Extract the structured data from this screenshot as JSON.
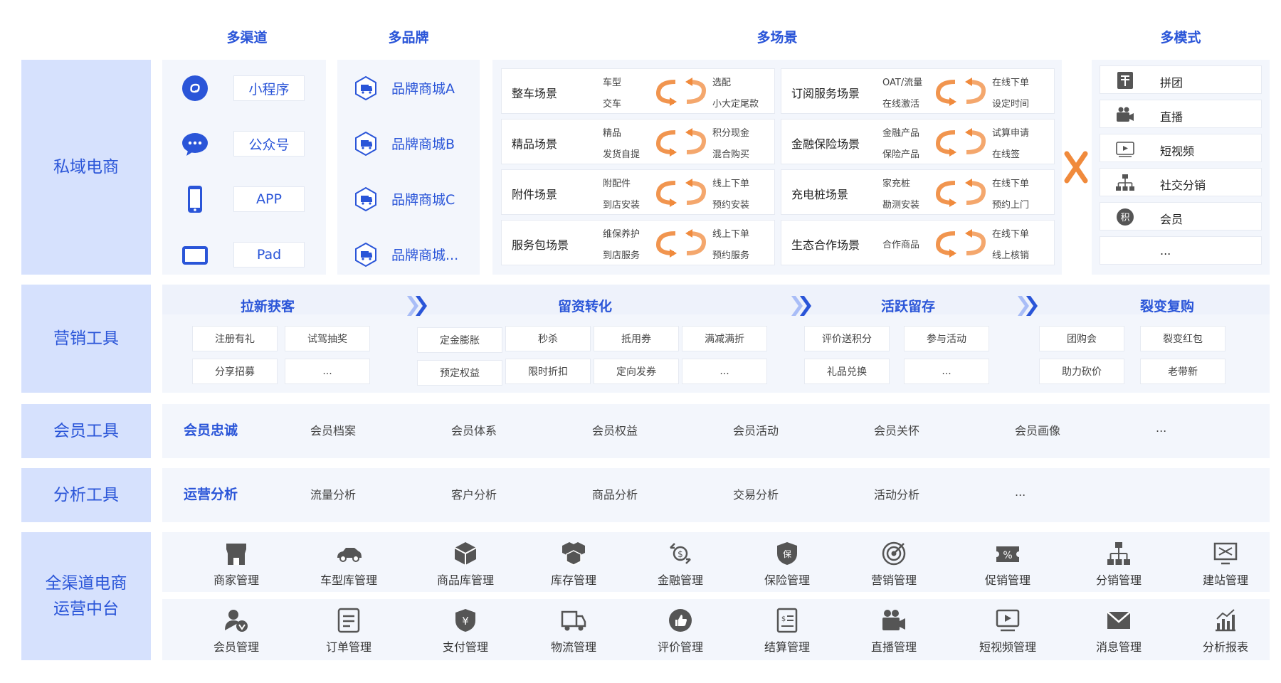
{
  "columns": {
    "channels": "多渠道",
    "brands": "多品牌",
    "scenes": "多场景",
    "modes": "多模式"
  },
  "rows": {
    "private": "私域电商",
    "marketing": "营销工具",
    "member": "会员工具",
    "analysis": "分析工具",
    "platform_line1": "全渠道电商",
    "platform_line2": "运营中台"
  },
  "channels": [
    "小程序",
    "公众号",
    "APP",
    "Pad"
  ],
  "brands": [
    "品牌商城A",
    "品牌商城B",
    "品牌商城C",
    "品牌商城..."
  ],
  "scenes": [
    {
      "name": "整车场景",
      "tl": "车型",
      "bl": "交车",
      "tr": "选配",
      "br": "小大定尾款"
    },
    {
      "name": "订阅服务场景",
      "tl": "OAT/流量",
      "bl": "在线激活",
      "tr": "在线下单",
      "br": "设定时间"
    },
    {
      "name": "精品场景",
      "tl": "精品",
      "bl": "发货自提",
      "tr": "积分现金",
      "br": "混合购买"
    },
    {
      "name": "金融保险场景",
      "tl": "金融产品",
      "bl": "保险产品",
      "tr": "试算申请",
      "br": "在线签"
    },
    {
      "name": "附件场景",
      "tl": "附配件",
      "bl": "到店安装",
      "tr": "线上下单",
      "br": "预约安装"
    },
    {
      "name": "充电桩场景",
      "tl": "家充桩",
      "bl": "勘测安装",
      "tr": "在线下单",
      "br": "预约上门"
    },
    {
      "name": "服务包场景",
      "tl": "维保养护",
      "bl": "到店服务",
      "tr": "线上下单",
      "br": "预约服务"
    },
    {
      "name": "生态合作场景",
      "tl": "合作商品",
      "bl": "",
      "tr": "在线下单",
      "br": "线上核销"
    }
  ],
  "cross_mark": "X",
  "modes": [
    "拼团",
    "直播",
    "短视频",
    "社交分销",
    "会员",
    "..."
  ],
  "mode_icons": [
    "group-buy-icon",
    "live-camera-icon",
    "video-play-icon",
    "org-chart-icon",
    "points-icon",
    ""
  ],
  "marketing": {
    "stages": [
      "拉新获客",
      "留资转化",
      "活跃留存",
      "裂变复购"
    ],
    "acquire": [
      "注册有礼",
      "试驾抽奖",
      "分享招募",
      "..."
    ],
    "convert": [
      "定金膨胀",
      "秒杀",
      "抵用券",
      "满减满折",
      "预定权益",
      "限时折扣",
      "定向发券",
      "..."
    ],
    "retain": [
      "评价送积分",
      "参与活动",
      "礼品兑换",
      "..."
    ],
    "fission": [
      "团购会",
      "裂变红包",
      "助力砍价",
      "老带新"
    ]
  },
  "member": {
    "head": "会员忠诚",
    "items": [
      "会员档案",
      "会员体系",
      "会员权益",
      "会员活动",
      "会员关怀",
      "会员画像",
      "..."
    ]
  },
  "analysis": {
    "head": "运营分析",
    "items": [
      "流量分析",
      "客户分析",
      "商品分析",
      "交易分析",
      "活动分析",
      "..."
    ]
  },
  "platform": {
    "row1": [
      "商家管理",
      "车型库管理",
      "商品库管理",
      "库存管理",
      "金融管理",
      "保险管理",
      "营销管理",
      "促销管理",
      "分销管理",
      "建站管理"
    ],
    "row2": [
      "会员管理",
      "订单管理",
      "支付管理",
      "物流管理",
      "评价管理",
      "结算管理",
      "直播管理",
      "短视频管理",
      "消息管理",
      "分析报表"
    ]
  },
  "colors": {
    "primary": "#2a55d8",
    "side_bg": "#d6e1fd",
    "panel_bg": "#f3f6fc",
    "accent_orange": "#f08a3c",
    "icon_gray": "#555555"
  }
}
